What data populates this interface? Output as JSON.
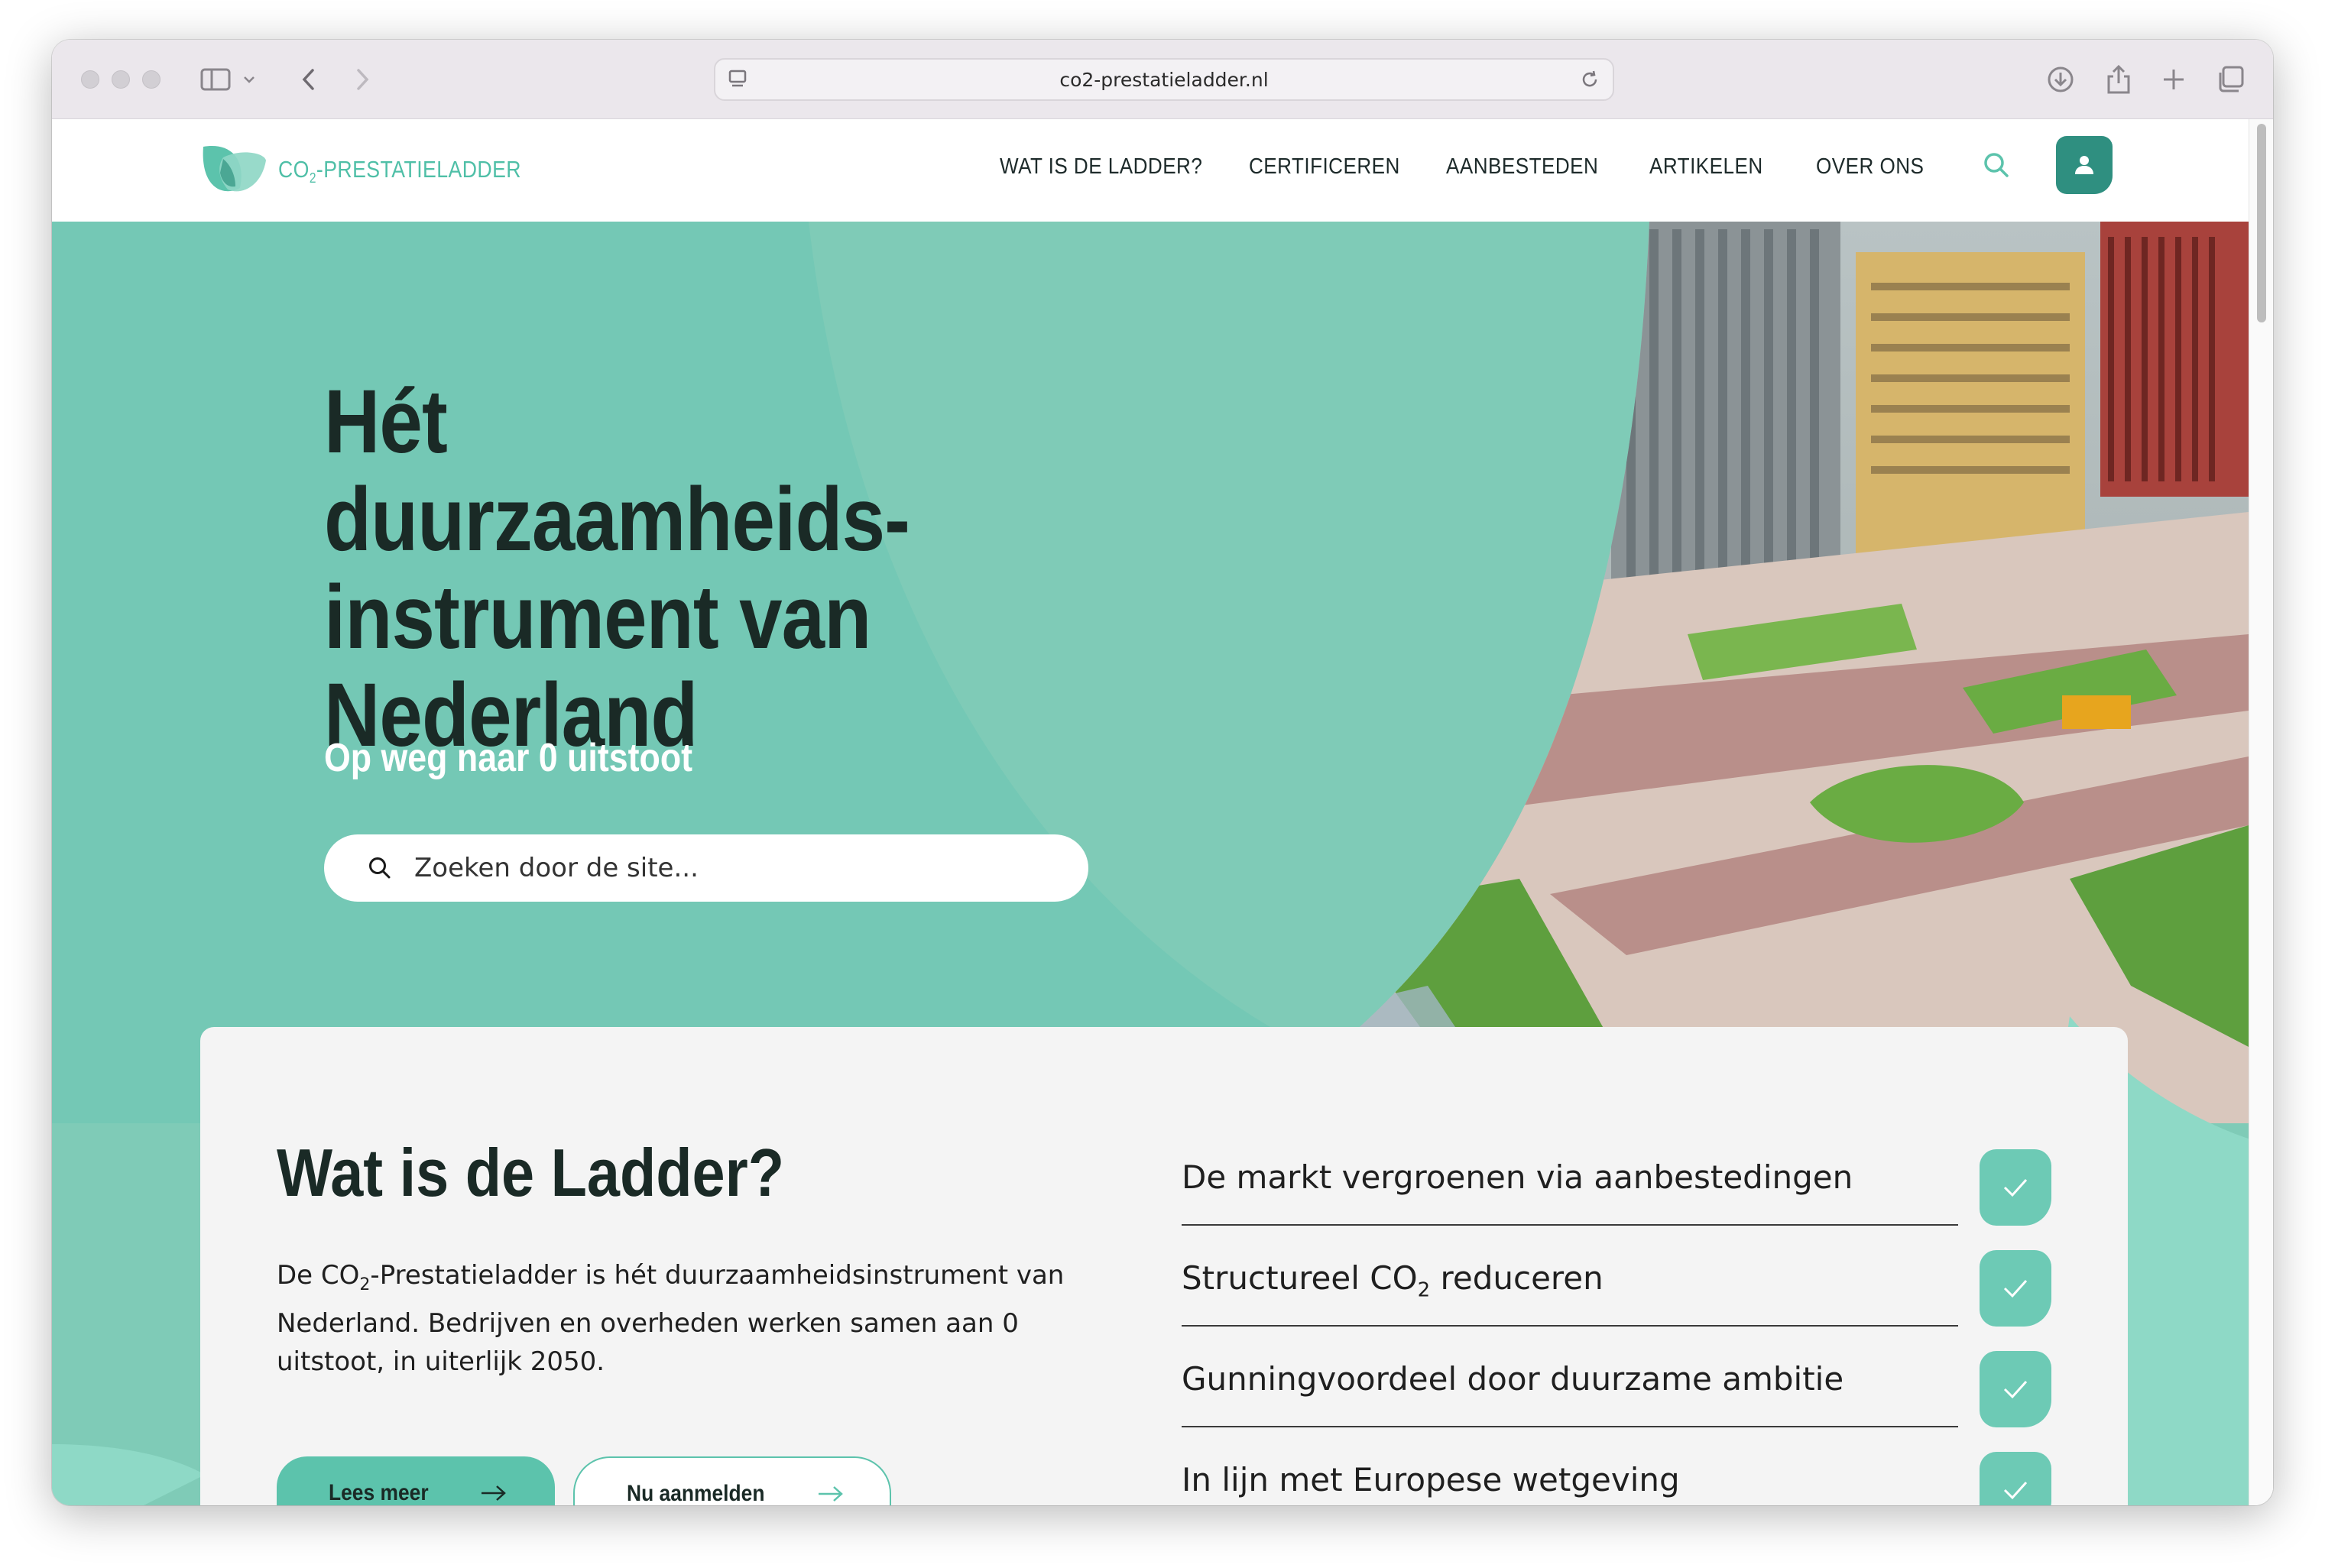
{
  "browser": {
    "url": "co2-prestatieladder.nl",
    "toolbar_icons": [
      "sidebar-icon",
      "chevron-down-icon",
      "back-icon",
      "forward-icon",
      "download-icon",
      "share-icon",
      "new-tab-icon",
      "tabs-overview-icon"
    ]
  },
  "site": {
    "logo_text_prefix": "CO",
    "logo_text_sub": "2",
    "logo_text_suffix": "-PRESTATIELADDER",
    "nav": [
      "WAT IS DE LADDER?",
      "CERTIFICEREN",
      "AANBESTEDEN",
      "ARTIKELEN",
      "OVER ONS"
    ],
    "colors": {
      "accent": "#5cc3ac",
      "hero_bg": "#7fcbb7",
      "dark_teal": "#2f8f80",
      "text_dark": "#1a2a26"
    }
  },
  "hero": {
    "headline_line1": "Hét duurzaamheids-",
    "headline_line2": "instrument van",
    "headline_line3": "Nederland",
    "subline": "Op weg naar 0 uitstoot",
    "search_placeholder": "Zoeken door de site..."
  },
  "intro": {
    "title": "Wat is de Ladder?",
    "body_part1": "De CO",
    "body_sub": "2",
    "body_part2": "-Prestatieladder is hét duurzaamheidsinstrument van Nederland. Bedrijven en overheden werken samen aan 0 uitstoot, in uiterlijk 2050.",
    "btn_primary": "Lees meer",
    "btn_secondary": "Nu aanmelden",
    "bullets": [
      {
        "text": "De markt vergroenen via aanbestedingen"
      },
      {
        "text_part1": "Structureel CO",
        "text_sub": "2",
        "text_part2": " reduceren"
      },
      {
        "text": "Gunningvoordeel door duurzame ambitie"
      },
      {
        "text": "In lijn met Europese wetgeving"
      }
    ]
  }
}
